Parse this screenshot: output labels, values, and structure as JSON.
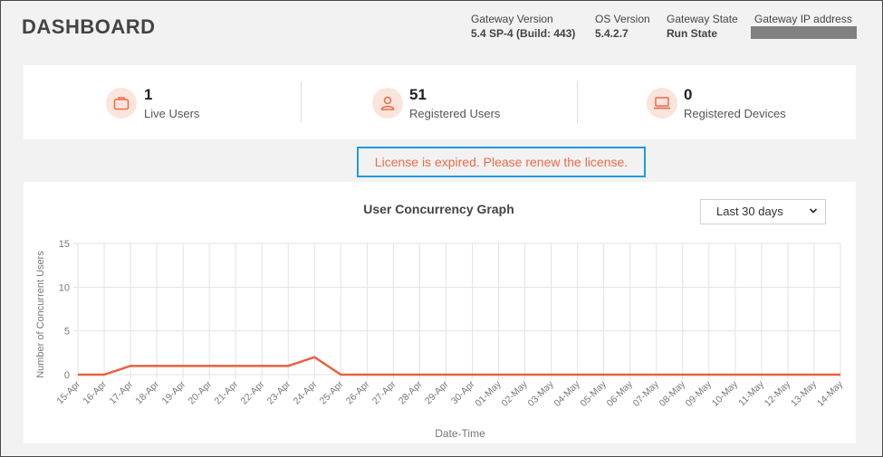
{
  "header": {
    "title": "DASHBOARD",
    "gateway_version_label": "Gateway Version",
    "gateway_version_value": "5.4 SP-4 (Build: 443)",
    "os_version_label": "OS Version",
    "os_version_value": "5.4.2.7",
    "gateway_state_label": "Gateway State",
    "gateway_state_value": "Run State",
    "gateway_ip_label": "Gateway IP address"
  },
  "stats": [
    {
      "icon": "briefcase-icon",
      "value": "1",
      "label": "Live Users"
    },
    {
      "icon": "user-icon",
      "value": "51",
      "label": "Registered Users"
    },
    {
      "icon": "laptop-icon",
      "value": "0",
      "label": "Registered Devices"
    }
  ],
  "license_message": "License is expired. Please renew the license.",
  "range_select": {
    "selected": "Last 30 days"
  },
  "colors": {
    "accent": "#ef6a4a",
    "line": "#e8623f",
    "highlight": "#1e9be0",
    "icon_bg": "#fbe4dc"
  },
  "chart_data": {
    "type": "line",
    "title": "User Concurrency Graph",
    "xlabel": "Date-Time",
    "ylabel": "Number of Concurrent Users",
    "ylim": [
      0,
      15
    ],
    "yticks": [
      0,
      5,
      10,
      15
    ],
    "grid": true,
    "categories": [
      "15-Apr",
      "16-Apr",
      "17-Apr",
      "18-Apr",
      "19-Apr",
      "20-Apr",
      "21-Apr",
      "22-Apr",
      "23-Apr",
      "24-Apr",
      "25-Apr",
      "26-Apr",
      "27-Apr",
      "28-Apr",
      "29-Apr",
      "30-Apr",
      "01-May",
      "02-May",
      "03-May",
      "04-May",
      "05-May",
      "06-May",
      "07-May",
      "08-May",
      "09-May",
      "10-May",
      "11-May",
      "12-May",
      "13-May",
      "14-May"
    ],
    "series": [
      {
        "values": [
          0,
          0,
          1,
          1,
          1,
          1,
          1,
          1,
          1,
          2,
          0,
          0,
          0,
          0,
          0,
          0,
          0,
          0,
          0,
          0,
          0,
          0,
          0,
          0,
          0,
          0,
          0,
          0,
          0,
          0
        ]
      }
    ]
  }
}
